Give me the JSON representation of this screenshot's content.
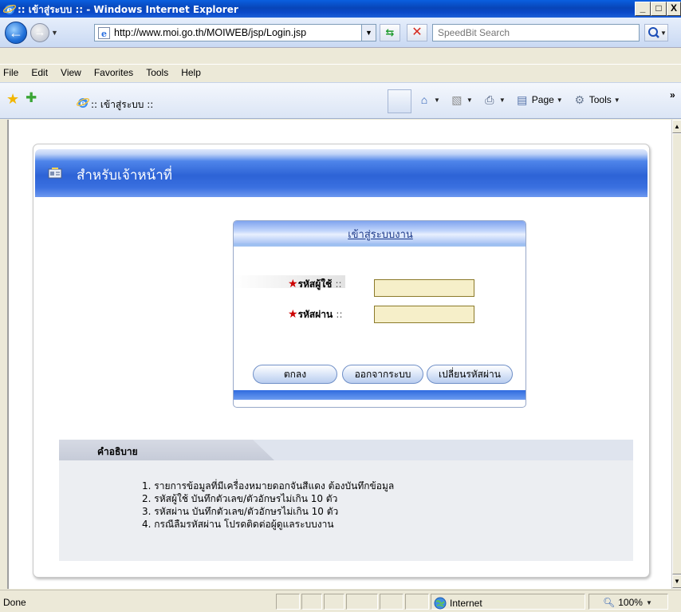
{
  "window": {
    "title": ":: เข้าสู่ระบบ :: - Windows Internet Explorer",
    "minimize": "_",
    "maximize": "□",
    "close": "X"
  },
  "address": {
    "url": "http://www.moi.go.th/MOIWEB/jsp/Login.jsp",
    "search_placeholder": "SpeedBit Search"
  },
  "menu": {
    "items": [
      "File",
      "Edit",
      "View",
      "Favorites",
      "Tools",
      "Help"
    ]
  },
  "tabs": {
    "active_label": ":: เข้าสู่ระบบ ::"
  },
  "commandbar": {
    "page": "Page",
    "tools": "Tools",
    "chevron": "»"
  },
  "page": {
    "header_title": "สำหรับเจ้าหน้าที่",
    "login": {
      "title": "เข้าสู่ระบบงาน",
      "username_label": "รหัสผู้ใช้",
      "password_label": "รหัสผ่าน",
      "sep": "::",
      "username_value": "",
      "password_value": "",
      "ok_button": "ตกลง",
      "logout_button": "ออกจากระบบ",
      "change_password_button": "เปลี่ยนรหัสผ่าน"
    },
    "description": {
      "title": "คำอธิบาย",
      "items": [
        "1. รายการข้อมูลที่มีเครื่องหมายดอกจันสีแดง ต้องบันทึกข้อมูล",
        "2. รหัสผู้ใช้ บันทึกตัวเลข/ตัวอักษรไม่เกิน 10 ตัว",
        "3. รหัสผ่าน บันทึกตัวเลข/ตัวอักษรไม่เกิน 10 ตัว",
        "4. กรณีลืมรหัสผ่าน โปรดติดต่อผู้ดูแลระบบงาน"
      ]
    }
  },
  "status": {
    "text": "Done",
    "zone": "Internet",
    "zoom": "100%"
  },
  "colors": {
    "titlebar": "#0a48c8",
    "header_blue": "#2d63d6",
    "required_star": "#cc0000",
    "field_bg": "#f6efc9"
  }
}
